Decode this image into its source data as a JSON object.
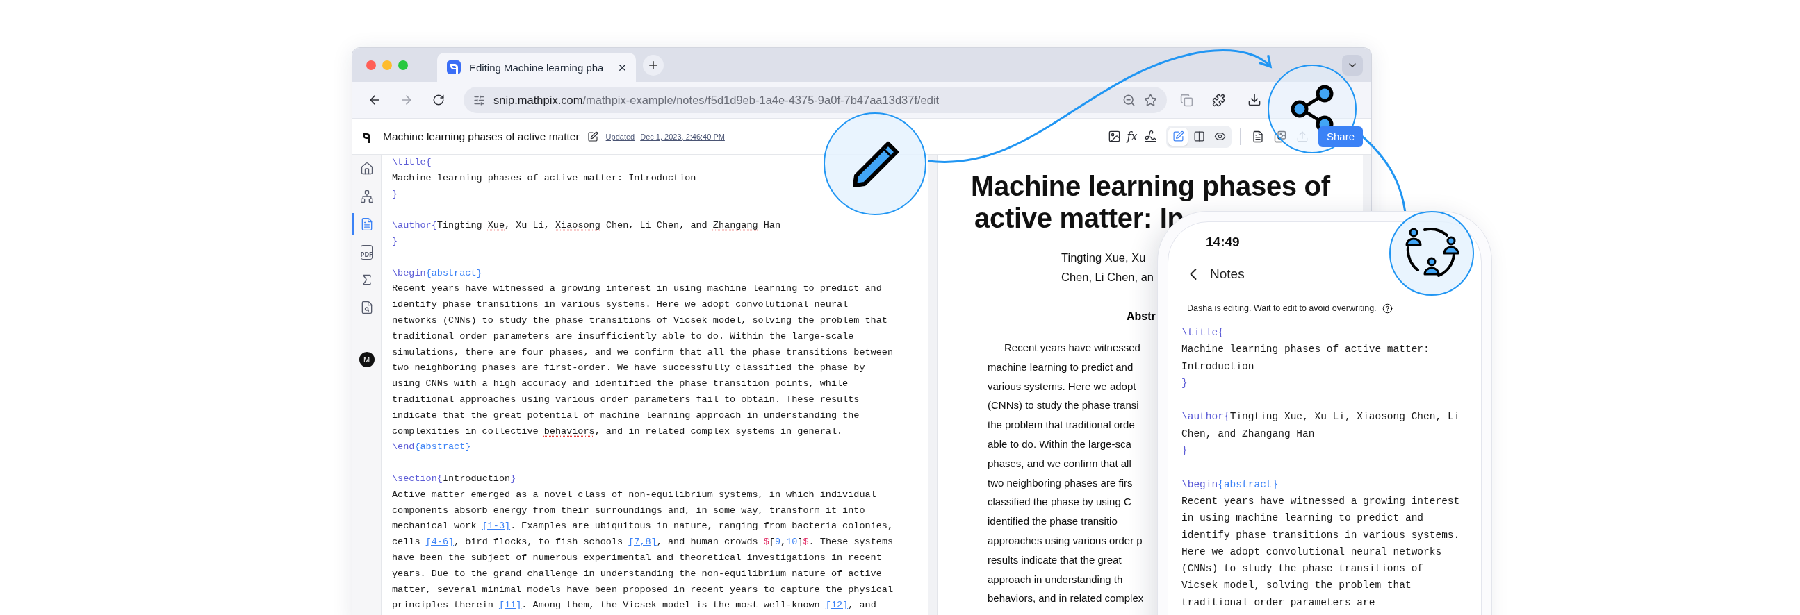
{
  "browser": {
    "tabs": [
      {
        "title": "Editing Machine learning pha",
        "selected": true
      }
    ],
    "url": {
      "host": "snip.mathpix.com",
      "path": "/mathpix-example/notes/f5d1d9eb-1a4e-4375-9a0f-7b47aa13d37f/edit"
    },
    "extensions": [
      {
        "kind": "mathpix",
        "disabled": true
      },
      {
        "kind": "puzzle",
        "disabled": false
      }
    ]
  },
  "sidebar": {
    "items": [
      {
        "kind": "home",
        "selected": false
      },
      {
        "kind": "tree",
        "selected": false
      },
      {
        "kind": "document",
        "selected": true
      },
      {
        "kind": "pdf",
        "label": "PDF",
        "selected": false
      },
      {
        "kind": "sigma",
        "selected": false
      },
      {
        "kind": "file-search",
        "selected": false
      }
    ],
    "avatar": "M"
  },
  "toolbar": {
    "title": "Machine learning phases of active matter",
    "updated_label": "Updated",
    "updated_date": "Dec 1, 2023, 2:46:40 PM",
    "tools": [
      {
        "kind": "image"
      },
      {
        "kind": "formula",
        "label": "fx"
      },
      {
        "kind": "scribble"
      }
    ],
    "view_modes": [
      {
        "kind": "edit",
        "selected": true
      },
      {
        "kind": "split",
        "selected": false
      },
      {
        "kind": "preview",
        "selected": false
      }
    ],
    "actions": [
      {
        "kind": "document",
        "disabled": false
      },
      {
        "kind": "images",
        "disabled": false
      },
      {
        "kind": "upload",
        "disabled": true
      }
    ],
    "share_button": "Share"
  },
  "editor": {
    "lines": [
      {
        "kind": "code",
        "segs": [
          {
            "kind": "cmd",
            "text": "\\title"
          },
          {
            "kind": "brace",
            "text": "{"
          }
        ]
      },
      {
        "kind": "code",
        "segs": [
          {
            "kind": "text",
            "text": "Machine learning phases of active matter: Introduction"
          }
        ]
      },
      {
        "kind": "code",
        "segs": [
          {
            "kind": "brace",
            "text": "}"
          }
        ]
      },
      {
        "kind": "blank"
      },
      {
        "kind": "code",
        "segs": [
          {
            "kind": "cmd",
            "text": "\\author"
          },
          {
            "kind": "brace",
            "text": "{"
          },
          {
            "kind": "text",
            "text": "Tingting "
          },
          {
            "kind": "spell",
            "text": "Xue"
          },
          {
            "kind": "text",
            "text": ", Xu Li, "
          },
          {
            "kind": "spell",
            "text": "Xiaosong"
          },
          {
            "kind": "text",
            "text": " Chen, Li Chen, and "
          },
          {
            "kind": "spell",
            "text": "Zhangang"
          },
          {
            "kind": "text",
            "text": " Han"
          }
        ]
      },
      {
        "kind": "code",
        "segs": [
          {
            "kind": "brace",
            "text": "}"
          }
        ]
      },
      {
        "kind": "blank"
      },
      {
        "kind": "code",
        "segs": [
          {
            "kind": "cmd",
            "text": "\\begin"
          },
          {
            "kind": "arg",
            "text": "{abstract}"
          }
        ]
      },
      {
        "kind": "code",
        "segs": [
          {
            "kind": "text",
            "text": "Recent years have witnessed a growing interest in using machine learning to predict and"
          }
        ]
      },
      {
        "kind": "code",
        "segs": [
          {
            "kind": "text",
            "text": "identify phase transitions in various systems. Here we adopt convolutional neural"
          }
        ]
      },
      {
        "kind": "code",
        "segs": [
          {
            "kind": "text",
            "text": "networks (CNNs) to study the phase transitions of Vicsek model, solving the problem that"
          }
        ]
      },
      {
        "kind": "code",
        "segs": [
          {
            "kind": "text",
            "text": "traditional order parameters are insufficiently able to do. Within the large-scale"
          }
        ]
      },
      {
        "kind": "code",
        "segs": [
          {
            "kind": "text",
            "text": "simulations, there are four phases, and we confirm that all the phase transitions between"
          }
        ]
      },
      {
        "kind": "code",
        "segs": [
          {
            "kind": "text",
            "text": "two neighboring phases are first-order. We have successfully classified the phase by"
          }
        ]
      },
      {
        "kind": "code",
        "segs": [
          {
            "kind": "text",
            "text": "using CNNs with a high accuracy and identified the phase transition points, while"
          }
        ]
      },
      {
        "kind": "code",
        "segs": [
          {
            "kind": "text",
            "text": "traditional approaches using various order parameters fail to obtain. These results"
          }
        ]
      },
      {
        "kind": "code",
        "segs": [
          {
            "kind": "text",
            "text": "indicate that the great potential of machine learning approach in understanding the"
          }
        ]
      },
      {
        "kind": "code",
        "segs": [
          {
            "kind": "text",
            "text": "complexities in collective "
          },
          {
            "kind": "spell",
            "text": "behaviors"
          },
          {
            "kind": "text",
            "text": ", and in related complex systems in general."
          }
        ]
      },
      {
        "kind": "code",
        "segs": [
          {
            "kind": "cmd",
            "text": "\\end"
          },
          {
            "kind": "arg",
            "text": "{abstract}"
          }
        ]
      },
      {
        "kind": "blank"
      },
      {
        "kind": "code",
        "segs": [
          {
            "kind": "cmd",
            "text": "\\section"
          },
          {
            "kind": "brace",
            "text": "{"
          },
          {
            "kind": "text",
            "text": "Introduction"
          },
          {
            "kind": "brace",
            "text": "}"
          }
        ]
      },
      {
        "kind": "code",
        "segs": [
          {
            "kind": "text",
            "text": "Active matter emerged as a novel class of non-equilibrium systems, in which individual"
          }
        ]
      },
      {
        "kind": "code",
        "segs": [
          {
            "kind": "text",
            "text": "components absorb energy from their surroundings and, in some way, transform it into"
          }
        ]
      },
      {
        "kind": "code",
        "segs": [
          {
            "kind": "text",
            "text": "mechanical work "
          },
          {
            "kind": "link",
            "text": "[1-3]"
          },
          {
            "kind": "text",
            "text": ". Examples are ubiquitous in nature, ranging from bacteria colonies,"
          }
        ]
      },
      {
        "kind": "code",
        "segs": [
          {
            "kind": "text",
            "text": "cells "
          },
          {
            "kind": "link",
            "text": "[4-6]"
          },
          {
            "kind": "text",
            "text": ", bird flocks, to fish schools "
          },
          {
            "kind": "link",
            "text": "[7,8]"
          },
          {
            "kind": "text",
            "text": ", and human crowds "
          },
          {
            "kind": "math",
            "text": "$"
          },
          {
            "kind": "text",
            "text": "["
          },
          {
            "kind": "num",
            "text": "9"
          },
          {
            "kind": "text",
            "text": ","
          },
          {
            "kind": "num",
            "text": "10"
          },
          {
            "kind": "text",
            "text": "]"
          },
          {
            "kind": "math",
            "text": "$"
          },
          {
            "kind": "text",
            "text": ". These systems"
          }
        ]
      },
      {
        "kind": "code",
        "segs": [
          {
            "kind": "text",
            "text": "have been the subject of numerous experimental and theoretical investigations in recent"
          }
        ]
      },
      {
        "kind": "code",
        "segs": [
          {
            "kind": "text",
            "text": "years. Due to the grand challenge in understanding the non-equilibrium nature of active"
          }
        ]
      },
      {
        "kind": "code",
        "segs": [
          {
            "kind": "text",
            "text": "matter, several minimal models have been proposed in recent years to capture the physical"
          }
        ]
      },
      {
        "kind": "code",
        "segs": [
          {
            "kind": "text",
            "text": "principles therein "
          },
          {
            "kind": "link",
            "text": "[11]"
          },
          {
            "kind": "text",
            "text": ". Among them, the Vicsek model is the most well-known "
          },
          {
            "kind": "link",
            "text": "[12]"
          },
          {
            "kind": "text",
            "text": ", and"
          }
        ]
      }
    ]
  },
  "preview": {
    "title_lines": [
      "Machine learning phases of",
      "active matter: In"
    ],
    "author_lines": [
      "Tingting Xue, Xu",
      "Chen, Li Chen, an"
    ],
    "abstract_heading": "Abstr",
    "abstract_lines": [
      "Recent years have witnessed",
      "machine learning to predict and",
      "various systems. Here we adopt",
      "(CNNs) to study the phase transi",
      "the problem that traditional orde",
      "able to do. Within the large-sca",
      "phases, and we confirm that all",
      "two neighboring phases are firs",
      "classified the phase by using C",
      "identified the phase transitio",
      "approaches using various order p",
      "results indicate that the great",
      "approach in understanding th",
      "behaviors, and in related complex"
    ]
  },
  "phone": {
    "time": "14:49",
    "back_label": "Notes",
    "notice": "Dasha is editing. Wait to edit to avoid overwriting.",
    "lines": [
      {
        "kind": "code",
        "segs": [
          {
            "kind": "cmd",
            "text": "\\title"
          },
          {
            "kind": "brace",
            "text": "{"
          }
        ]
      },
      {
        "kind": "code",
        "segs": [
          {
            "kind": "text",
            "text": "Machine learning phases of active matter:"
          }
        ]
      },
      {
        "kind": "code",
        "segs": [
          {
            "kind": "text",
            "text": "Introduction"
          }
        ]
      },
      {
        "kind": "code",
        "segs": [
          {
            "kind": "brace",
            "text": "}"
          }
        ]
      },
      {
        "kind": "blank"
      },
      {
        "kind": "code",
        "segs": [
          {
            "kind": "cmd",
            "text": "\\author"
          },
          {
            "kind": "brace",
            "text": "{"
          },
          {
            "kind": "text",
            "text": "Tingting Xue, Xu Li, Xiaosong Chen, Li"
          }
        ]
      },
      {
        "kind": "code",
        "segs": [
          {
            "kind": "text",
            "text": "Chen, and Zhangang Han"
          }
        ]
      },
      {
        "kind": "code",
        "segs": [
          {
            "kind": "brace",
            "text": "}"
          }
        ]
      },
      {
        "kind": "blank"
      },
      {
        "kind": "code",
        "segs": [
          {
            "kind": "cmd",
            "text": "\\begin"
          },
          {
            "kind": "arg",
            "text": "{abstract}"
          }
        ]
      },
      {
        "kind": "code",
        "segs": [
          {
            "kind": "text",
            "text": "Recent years have witnessed a growing interest"
          }
        ]
      },
      {
        "kind": "code",
        "segs": [
          {
            "kind": "text",
            "text": "in using machine learning to predict and"
          }
        ]
      },
      {
        "kind": "code",
        "segs": [
          {
            "kind": "text",
            "text": "identify phase transitions in various systems."
          }
        ]
      },
      {
        "kind": "code",
        "segs": [
          {
            "kind": "text",
            "text": "Here we adopt convolutional neural networks"
          }
        ]
      },
      {
        "kind": "code",
        "segs": [
          {
            "kind": "text",
            "text": "(CNNs) to study the phase transitions of"
          }
        ]
      },
      {
        "kind": "code",
        "segs": [
          {
            "kind": "text",
            "text": "Vicsek model, solving the problem that"
          }
        ]
      },
      {
        "kind": "code",
        "segs": [
          {
            "kind": "text",
            "text": "traditional order parameters are"
          }
        ]
      }
    ]
  }
}
